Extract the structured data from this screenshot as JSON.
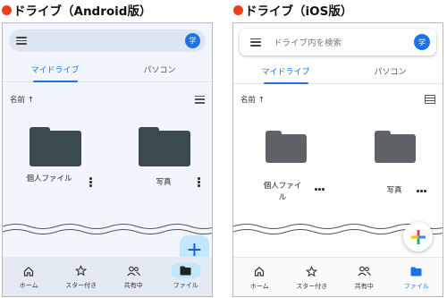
{
  "android": {
    "heading": "ドライブ（Android版）",
    "search": {
      "placeholder": "",
      "avatar_letter": "学"
    },
    "tabs": [
      {
        "label": "マイドライブ"
      },
      {
        "label": "パソコン"
      }
    ],
    "sort_label": "名前 ↑",
    "folders": [
      {
        "name": "個人ファイル"
      },
      {
        "name": "写真"
      }
    ],
    "fab": "+",
    "nav": [
      {
        "label": "ホーム",
        "icon": "home-icon"
      },
      {
        "label": "スター付き",
        "icon": "star-icon"
      },
      {
        "label": "共有中",
        "icon": "shared-icon"
      },
      {
        "label": "ファイル",
        "icon": "folder-icon"
      }
    ]
  },
  "ios": {
    "heading": "ドライブ（iOS版）",
    "search": {
      "placeholder": "ドライブ内を検索",
      "avatar_letter": "学"
    },
    "tabs": [
      {
        "label": "マイドライブ"
      },
      {
        "label": "パソコン"
      }
    ],
    "sort_label": "名前 ↑",
    "folders": [
      {
        "name": "個人ファイル"
      },
      {
        "name": "写真"
      }
    ],
    "nav": [
      {
        "label": "ホーム",
        "icon": "home-icon"
      },
      {
        "label": "スター付き",
        "icon": "star-icon"
      },
      {
        "label": "共有中",
        "icon": "shared-icon"
      },
      {
        "label": "ファイル",
        "icon": "folder-icon"
      }
    ]
  },
  "colors": {
    "accent": "#1a73e8",
    "heading_dot": "#e8401c",
    "android_folder": "#3a4a50",
    "ios_folder": "#5f6368",
    "android_fab": "#c2e7ff"
  }
}
